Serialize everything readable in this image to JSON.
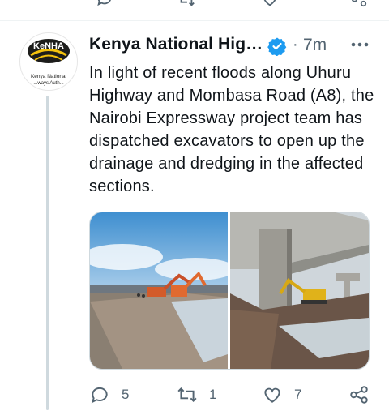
{
  "tweet": {
    "author_name": "Kenya National Hig…",
    "verified": true,
    "separator": "·",
    "time": "7m",
    "avatar_logo_text": "KeNHA",
    "avatar_caption": "Kenya National Highways Authority",
    "text": "In light of recent floods along Uhuru Highway and Mombasa Road (A8), the Nairobi Expressway project team has dispatched excavators to open up the drainage and dredging in the affected sections.",
    "media": [
      {
        "name": "photo-flooded-road-excavators"
      },
      {
        "name": "photo-excavator-under-expressway"
      }
    ],
    "actions": {
      "reply_count": "5",
      "retweet_count": "1",
      "like_count": "7"
    }
  },
  "colors": {
    "verified_blue": "#1d9bf0",
    "secondary_text": "#536471",
    "thread_line": "#cfd9de"
  }
}
